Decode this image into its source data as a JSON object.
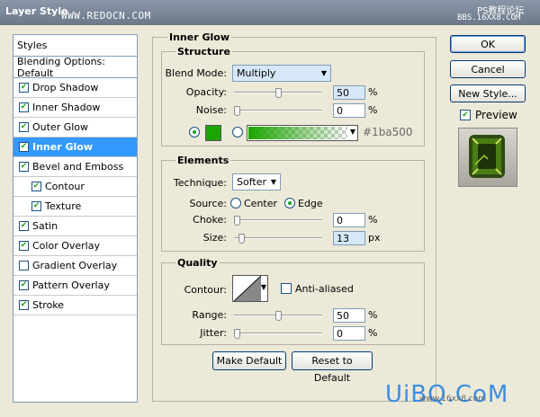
{
  "window": {
    "title": "Layer Style",
    "watermark_top": "WWW.REDOCN.COM",
    "watermark_top_right_1": "PS教程论坛",
    "watermark_top_right_2": "BBS.16XX8.COM",
    "watermark_bottom": "UiBQ.CoM",
    "watermark_bottom_small": "www.16xx8.com"
  },
  "sidebar": {
    "header": "Styles",
    "blending": "Blending Options: Default",
    "items": [
      {
        "label": "Drop Shadow",
        "checked": true
      },
      {
        "label": "Inner Shadow",
        "checked": true
      },
      {
        "label": "Outer Glow",
        "checked": true
      },
      {
        "label": "Inner Glow",
        "checked": true,
        "selected": true
      },
      {
        "label": "Bevel and Emboss",
        "checked": true
      },
      {
        "label": "Contour",
        "checked": true,
        "indent": true
      },
      {
        "label": "Texture",
        "checked": true,
        "indent": true
      },
      {
        "label": "Satin",
        "checked": true
      },
      {
        "label": "Color Overlay",
        "checked": true
      },
      {
        "label": "Gradient Overlay",
        "checked": false
      },
      {
        "label": "Pattern Overlay",
        "checked": true
      },
      {
        "label": "Stroke",
        "checked": true
      }
    ]
  },
  "panel": {
    "title": "Inner Glow",
    "structure": {
      "title": "Structure",
      "blend_mode_label": "Blend Mode:",
      "blend_mode": "Multiply",
      "opacity_label": "Opacity:",
      "opacity": "50",
      "opacity_fraction": 0.5,
      "opacity_unit": "%",
      "noise_label": "Noise:",
      "noise": "0",
      "noise_fraction": 0,
      "noise_unit": "%",
      "color_hex": "#1ba500",
      "color_label": "#1ba500"
    },
    "elements": {
      "title": "Elements",
      "technique_label": "Technique:",
      "technique": "Softer",
      "source_label": "Source:",
      "source_center": "Center",
      "source_edge": "Edge",
      "choke_label": "Choke:",
      "choke": "0",
      "choke_fraction": 0,
      "choke_unit": "%",
      "size_label": "Size:",
      "size": "13",
      "size_fraction": 0.052,
      "size_unit": "px"
    },
    "quality": {
      "title": "Quality",
      "contour_label": "Contour:",
      "antialiased": "Anti-aliased",
      "range_label": "Range:",
      "range": "50",
      "range_fraction": 0.5,
      "range_unit": "%",
      "jitter_label": "Jitter:",
      "jitter": "0",
      "jitter_fraction": 0,
      "jitter_unit": "%"
    },
    "make_default": "Make Default",
    "reset_default": "Reset to Default"
  },
  "actions": {
    "ok": "OK",
    "cancel": "Cancel",
    "new_style": "New Style...",
    "preview": "Preview"
  }
}
